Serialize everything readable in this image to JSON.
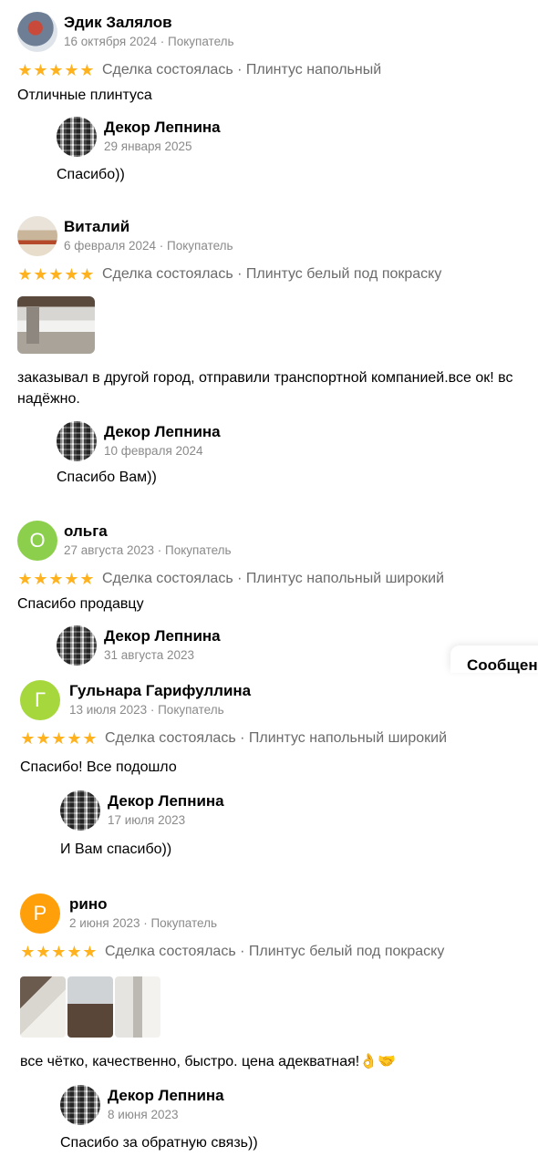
{
  "reviews": [
    {
      "name": "Эдик Залялов",
      "meta": "16 октября 2024 · Покупатель",
      "deal": "Сделка состоялась · Плинтус напольный",
      "text": [
        "Отличные плинтуса"
      ],
      "reply": {
        "name": "Декор Лепнина",
        "date": "29 января 2025",
        "text": "Спасибо))"
      }
    },
    {
      "name": "Виталий",
      "meta": "6 февраля 2024 · Покупатель",
      "deal": "Сделка состоялась · Плинтус белый под покраску",
      "text": [
        "заказывал в другой город, отправили транспортной компанией.все ок! вс",
        "надёжно."
      ],
      "reply": {
        "name": "Декор Лепнина",
        "date": "10 февраля 2024",
        "text": "Спасибо Вам))"
      }
    },
    {
      "name": "ольга",
      "avatar_letter": "О",
      "meta": "27 августа 2023 · Покупатель",
      "deal": "Сделка состоялась · Плинтус напольный широкий",
      "text": [
        "Спасибо продавцу"
      ],
      "reply": {
        "name": "Декор Лепнина",
        "date": "31 августа 2023",
        "text": ""
      }
    },
    {
      "name": "Гульнара Гарифуллина",
      "avatar_letter": "Г",
      "meta": "13 июля 2023 · Покупатель",
      "deal": "Сделка состоялась · Плинтус напольный широкий",
      "text": [
        "Спасибо! Все подошло"
      ],
      "reply": {
        "name": "Декор Лепнина",
        "date": "17 июля 2023",
        "text": "И Вам спасибо))"
      }
    },
    {
      "name": "рино",
      "avatar_letter": "Р",
      "meta": "2 июня 2023 · Покупатель",
      "deal": "Сделка состоялась · Плинтус белый под покраску",
      "text": [
        "все чётко, качественно, быстро. цена адекватная!👌🤝"
      ],
      "reply": {
        "name": "Декор Лепнина",
        "date": "8 июня 2023",
        "text": "Спасибо за обратную связь))"
      }
    }
  ],
  "rating_stars": "★",
  "floating_button": "Сообщения",
  "colors": {
    "star": "#ffb21e",
    "avatar_olga": "#8ccf4d",
    "avatar_gulnara": "#a6d83d",
    "avatar_rino": "#ff9f0a"
  }
}
